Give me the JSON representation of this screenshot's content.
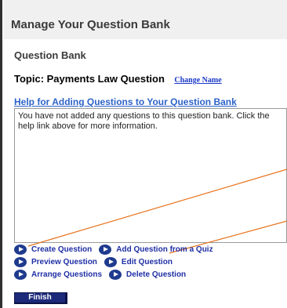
{
  "page": {
    "title": "Manage Your Question Bank"
  },
  "section": {
    "title": "Question Bank"
  },
  "topic": {
    "label": "Topic: Payments Law Question",
    "change_name": "Change Name"
  },
  "help": {
    "link": "Help for Adding Questions to Your Question Bank"
  },
  "question_box": {
    "text": "You have not added any questions to this question bank. Click the help link above for more information."
  },
  "actions": {
    "row1": [
      "Create Question",
      "Add Question from a Quiz"
    ],
    "row2": [
      "Preview Question",
      "Edit Question"
    ],
    "row3": [
      "Arrange Questions",
      "Delete Question"
    ]
  },
  "finish": {
    "label": "Finish"
  },
  "colors": {
    "annotation_line": "#e8731e",
    "link": "#2d63c8",
    "action": "#1f2fa4",
    "finish_bg": "#1d2a7a"
  },
  "icons": {
    "action_bullet": "play-circle-icon"
  }
}
